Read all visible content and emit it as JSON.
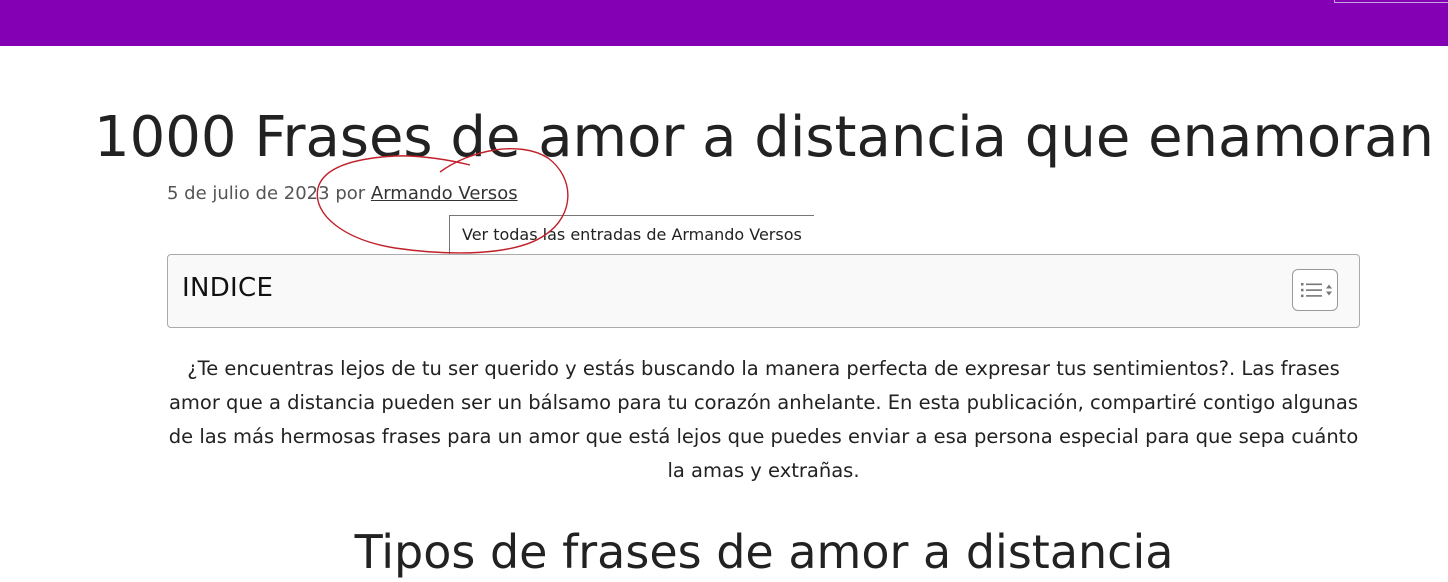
{
  "header": {
    "bar_color": "#8400b4"
  },
  "post": {
    "title": "1000 Frases de amor a distancia que enamoran",
    "date": "5 de julio de 2023",
    "by": "por",
    "author": "Armando Versos",
    "author_tooltip": "Ver todas las entradas de Armando Versos"
  },
  "toc": {
    "title": "INDICE",
    "toggle_icon": "list-toggle-icon"
  },
  "intro": "¿Te encuentras lejos de tu ser querido y estás buscando la manera perfecta de expresar tus sentimientos?. Las frases amor que a distancia pueden ser un bálsamo para tu corazón anhelante. En esta publicación, compartiré contigo algunas de las más hermosas frases para un amor que está lejos que puedes enviar a esa persona especial para que sepa cuánto la amas y extrañas.",
  "section_heading": "Tipos de frases de amor a distancia",
  "annotation_color": "#c0202a"
}
